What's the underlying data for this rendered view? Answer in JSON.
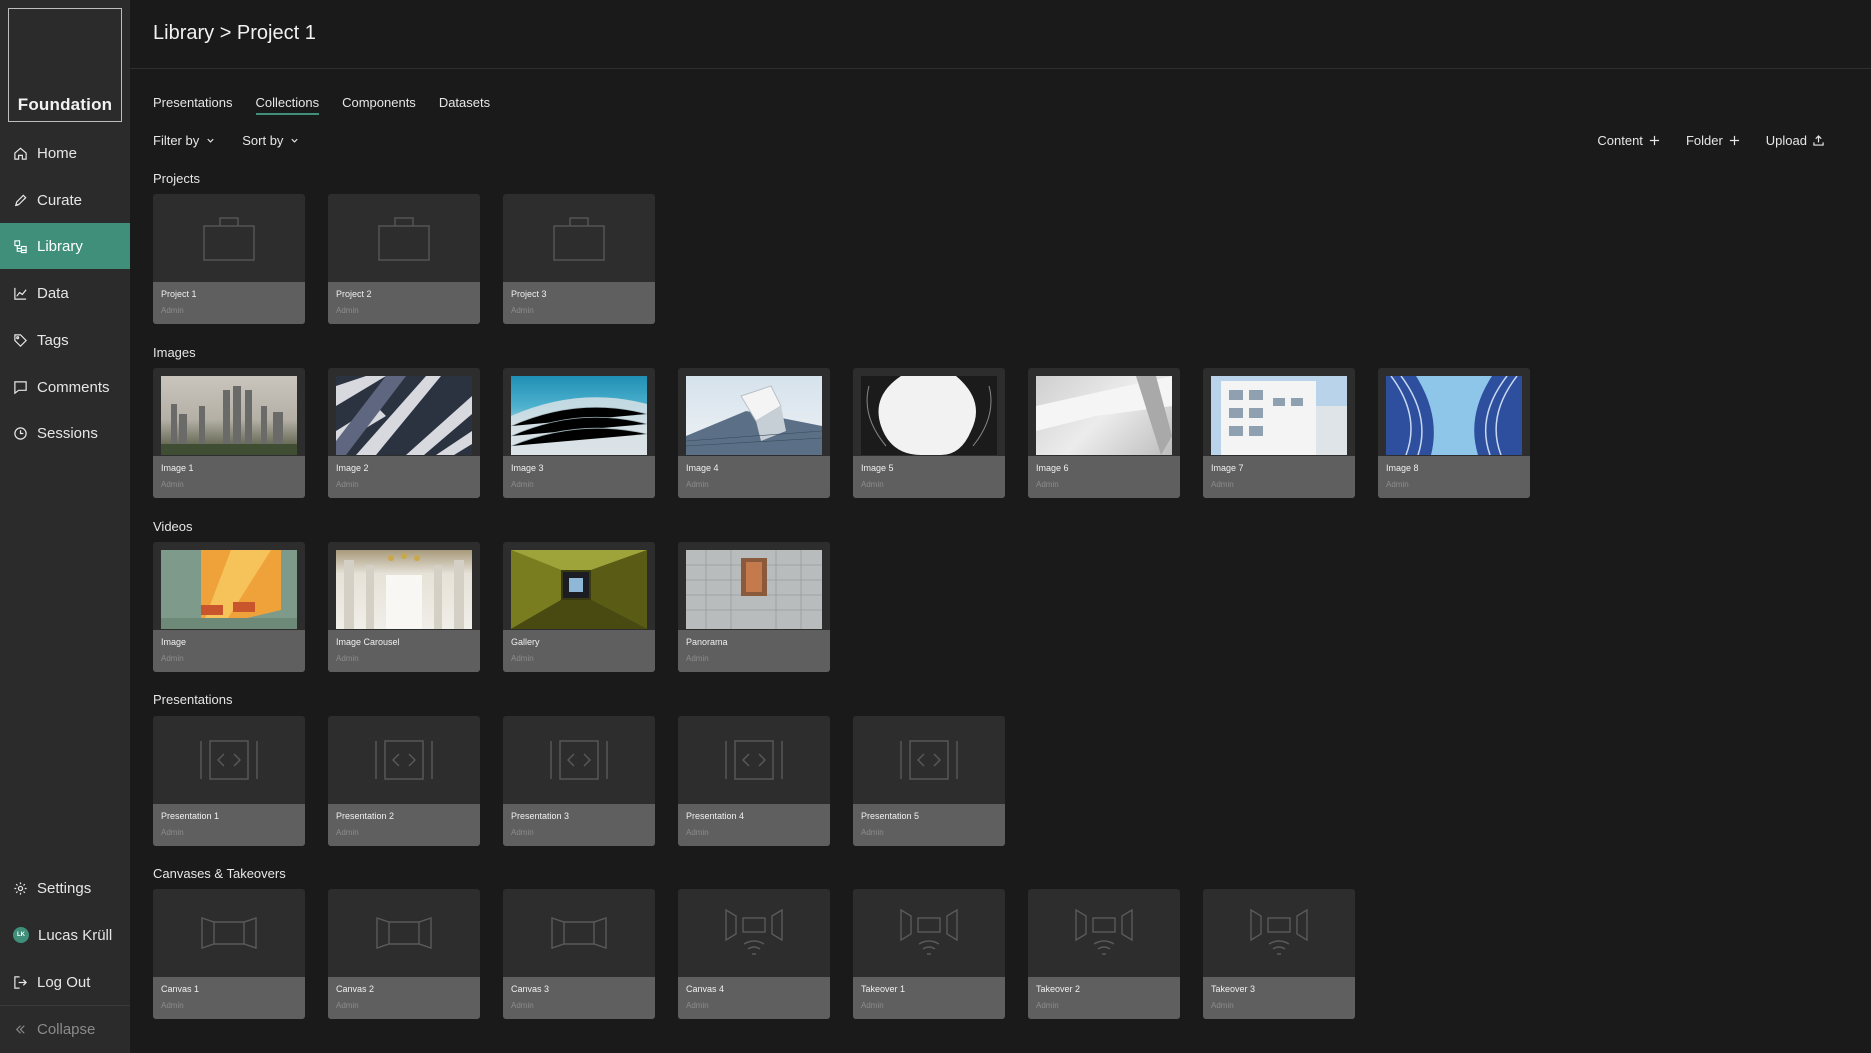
{
  "app": {
    "logo": "Foundation"
  },
  "sidebar": {
    "items": [
      {
        "label": "Home",
        "icon": "home-icon"
      },
      {
        "label": "Curate",
        "icon": "pencil-icon"
      },
      {
        "label": "Library",
        "icon": "library-icon",
        "active": true
      },
      {
        "label": "Data",
        "icon": "chart-icon"
      },
      {
        "label": "Tags",
        "icon": "tag-icon"
      },
      {
        "label": "Comments",
        "icon": "comment-icon"
      },
      {
        "label": "Sessions",
        "icon": "clock-icon"
      }
    ],
    "bottom": {
      "settings": "Settings",
      "user_name": "Lucas Krüll",
      "user_initials": "LK",
      "logout": "Log Out",
      "collapse": "Collapse"
    }
  },
  "header": {
    "breadcrumb": "Library > Project 1"
  },
  "tabs": [
    "Presentations",
    "Collections",
    "Components",
    "Datasets"
  ],
  "active_tab": "Collections",
  "toolbar": {
    "filter": "Filter by",
    "sort": "Sort by",
    "content": "Content",
    "folder": "Folder",
    "upload": "Upload"
  },
  "sections": {
    "projects": {
      "label": "Projects",
      "items": [
        {
          "title": "Project 1",
          "sub": "Admin"
        },
        {
          "title": "Project 2",
          "sub": "Admin"
        },
        {
          "title": "Project 3",
          "sub": "Admin"
        }
      ]
    },
    "images": {
      "label": "Images",
      "items": [
        {
          "title": "Image 1",
          "sub": "Admin"
        },
        {
          "title": "Image 2",
          "sub": "Admin"
        },
        {
          "title": "Image 3",
          "sub": "Admin"
        },
        {
          "title": "Image 4",
          "sub": "Admin"
        },
        {
          "title": "Image 5",
          "sub": "Admin"
        },
        {
          "title": "Image 6",
          "sub": "Admin"
        },
        {
          "title": "Image 7",
          "sub": "Admin"
        },
        {
          "title": "Image 8",
          "sub": "Admin"
        }
      ]
    },
    "videos": {
      "label": "Videos",
      "items": [
        {
          "title": "Image",
          "sub": "Admin"
        },
        {
          "title": "Image Carousel",
          "sub": "Admin"
        },
        {
          "title": "Gallery",
          "sub": "Admin"
        },
        {
          "title": "Panorama",
          "sub": "Admin"
        }
      ]
    },
    "presentations": {
      "label": "Presentations",
      "items": [
        {
          "title": "Presentation 1",
          "sub": "Admin"
        },
        {
          "title": "Presentation 2",
          "sub": "Admin"
        },
        {
          "title": "Presentation 3",
          "sub": "Admin"
        },
        {
          "title": "Presentation 4",
          "sub": "Admin"
        },
        {
          "title": "Presentation 5",
          "sub": "Admin"
        }
      ]
    },
    "canvases": {
      "label": "Canvases & Takeovers",
      "items": [
        {
          "title": "Canvas 1",
          "sub": "Admin"
        },
        {
          "title": "Canvas 2",
          "sub": "Admin"
        },
        {
          "title": "Canvas 3",
          "sub": "Admin"
        },
        {
          "title": "Canvas 4",
          "sub": "Admin"
        },
        {
          "title": "Takeover 1",
          "sub": "Admin"
        },
        {
          "title": "Takeover 2",
          "sub": "Admin"
        },
        {
          "title": "Takeover 3",
          "sub": "Admin"
        }
      ]
    }
  },
  "colors": {
    "accent": "#3f8f7a",
    "background": "#1a1a1a",
    "sidebar": "#2b2b2b",
    "card": "#2d2d2d",
    "card_footer": "#5f5f5f"
  }
}
